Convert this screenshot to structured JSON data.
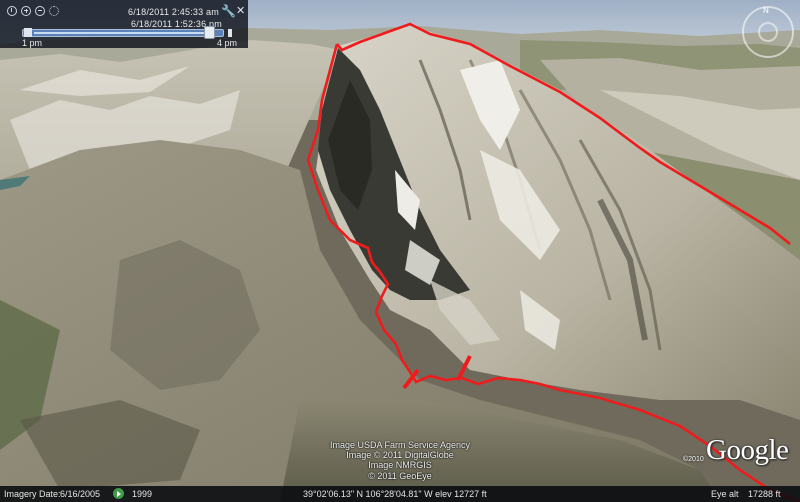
{
  "time_slider": {
    "start_time": "6/18/2011   2:45:33 am",
    "end_time": "6/18/2011   1:52:36 pm",
    "range_start_label": "1 pm",
    "range_end_label": "4 pm",
    "icons": [
      "clock-icon",
      "zoom-in-icon",
      "zoom-out-icon",
      "gear-icon",
      "wrench-icon",
      "close-icon"
    ]
  },
  "credits": {
    "lines": [
      "Image USDA Farm Service Agency",
      "Image © 2011 DigitalGlobe",
      "Image NMRGIS",
      "© 2011 GeoEye"
    ]
  },
  "logo": {
    "copyright": "©2010",
    "text": "Google"
  },
  "status_bar": {
    "imagery_date_label": "Imagery Date:",
    "imagery_date_value": "6/16/2005",
    "year": "1999",
    "coordinates": "39°02'06.13\" N  106°28'04.81\" W  elev 12727 ft",
    "eye_alt_label": "Eye alt",
    "eye_alt_value": "17288 ft"
  },
  "colors": {
    "route": "#ee1c1c",
    "sky": "#b9c6d6",
    "panel": "#0a0e16"
  }
}
